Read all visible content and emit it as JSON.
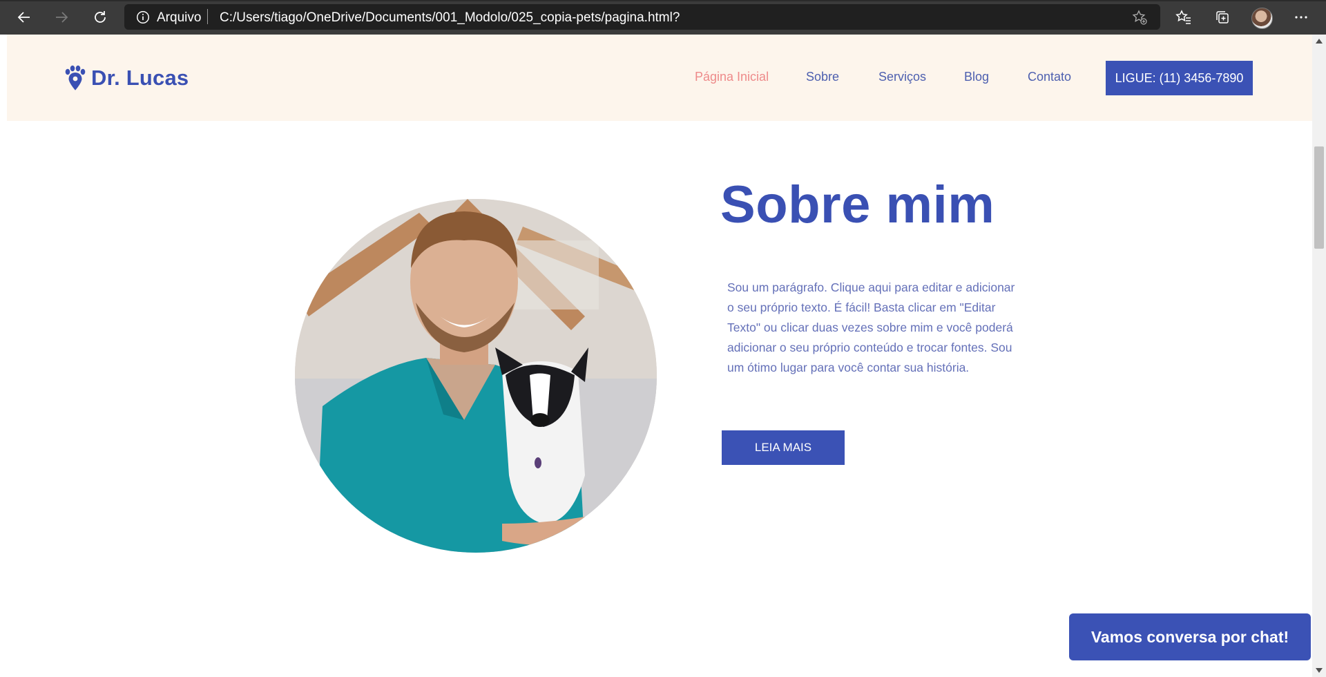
{
  "browser": {
    "address_label": "Arquivo",
    "url": "C:/Users/tiago/OneDrive/Documents/001_Modolo/025_copia-pets/pagina.html?"
  },
  "site": {
    "logo_text": "Dr. Lucas",
    "nav": [
      {
        "label": "Página Inicial",
        "active": true
      },
      {
        "label": "Sobre"
      },
      {
        "label": "Serviços"
      },
      {
        "label": "Blog"
      },
      {
        "label": "Contato"
      }
    ],
    "call_button": "LIGUE: (11) 3456-7890"
  },
  "hero": {
    "title": "Sobre mim",
    "text": "Sou um parágrafo. Clique aqui para editar e adicionar o seu próprio texto. É fácil! Basta clicar em \"Editar Texto\" ou clicar duas vezes sobre mim e você poderá adicionar o seu próprio conteúdo e trocar fontes. Sou um ótimo lugar para você contar sua história.",
    "button": "LEIA MAIS"
  },
  "chat_button": "Vamos conversa por chat!",
  "colors": {
    "brand_blue": "#3b52b5",
    "nav_active": "#ee8a8a",
    "header_bg": "#fdf5ec"
  }
}
